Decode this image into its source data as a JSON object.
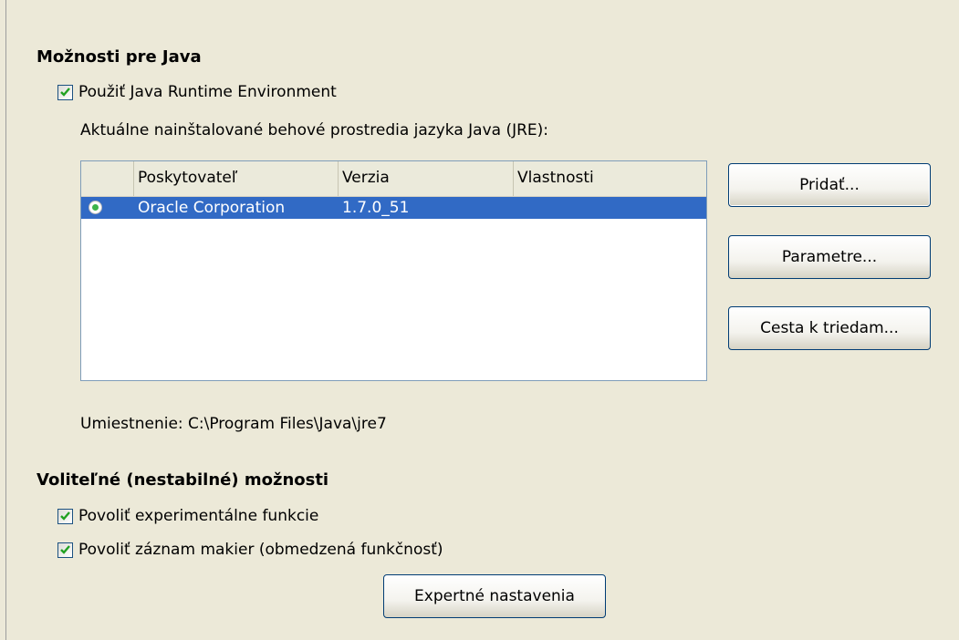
{
  "java": {
    "title": "Možnosti pre Java",
    "use_jre_label": "Použiť Java Runtime Environment",
    "use_jre_checked": true,
    "installed_label": "Aktuálne nainštalované behové prostredia jazyka Java (JRE):",
    "table": {
      "columns": [
        "",
        "Poskytovateľ",
        "Verzia",
        "Vlastnosti"
      ],
      "rows": [
        {
          "selected": true,
          "vendor": "Oracle Corporation",
          "version": "1.7.0_51",
          "features": ""
        }
      ]
    },
    "location_label": "Umiestnenie: C:\\Program Files\\Java\\jre7"
  },
  "buttons": {
    "add": "Pridať...",
    "parameters": "Parametre...",
    "classpath": "Cesta k triedam...",
    "expert": "Expertné nastavenia"
  },
  "optional": {
    "title": "Voliteľné (nestabilné) možnosti",
    "experimental_label": "Povoliť experimentálne funkcie",
    "experimental_checked": true,
    "macro_label": "Povoliť záznam makier (obmedzená funkčnosť)",
    "macro_checked": true
  },
  "colors": {
    "selection": "#316ac5",
    "check": "#21a121"
  }
}
